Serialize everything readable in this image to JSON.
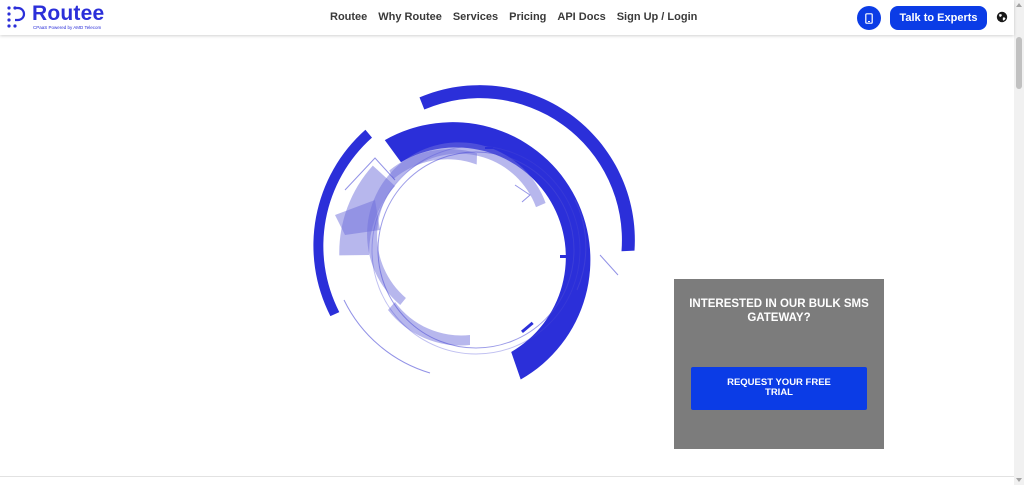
{
  "brand": {
    "name": "Routee",
    "tagline": "CPaaS Powered by AMD Telecom",
    "color": "#2b2fd9"
  },
  "nav": {
    "items": [
      {
        "label": "Routee"
      },
      {
        "label": "Why Routee"
      },
      {
        "label": "Services"
      },
      {
        "label": "Pricing"
      },
      {
        "label": "API Docs"
      },
      {
        "label": "Sign Up / Login"
      }
    ]
  },
  "header_actions": {
    "phone_icon": "phone-icon",
    "cta_label": "Talk to Experts",
    "language_icon": "globe-icon",
    "accent": "#0b3ce6"
  },
  "promo": {
    "title": "INTERESTED IN OUR BULK SMS GATEWAY?",
    "button_label": "REQUEST YOUR FREE TRIAL",
    "background": "#7c7c7c"
  }
}
